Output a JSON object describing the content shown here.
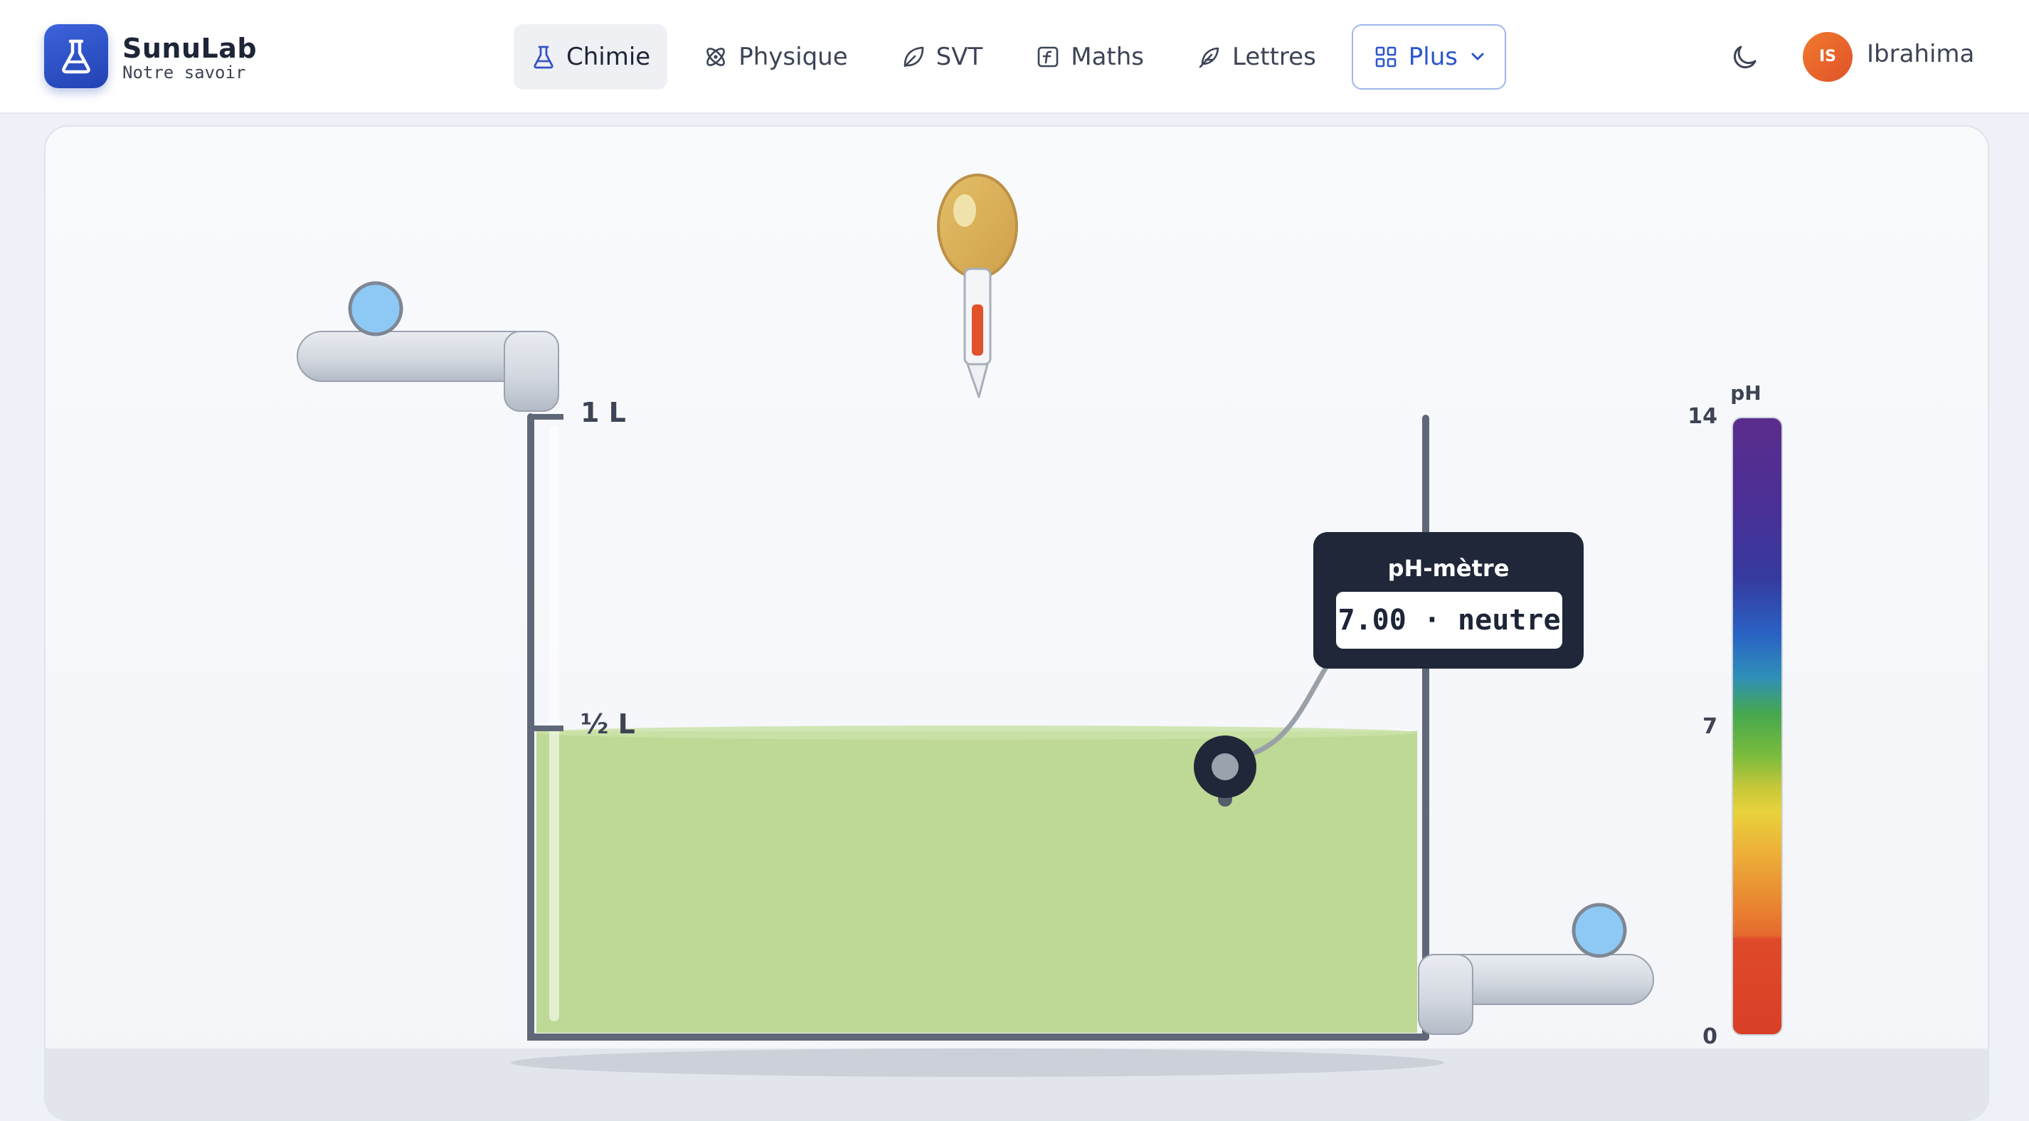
{
  "header": {
    "brand_name": "SunuLab",
    "brand_tagline": "Notre savoir",
    "nav": [
      {
        "label": "Chimie",
        "icon": "flask-icon",
        "active": true
      },
      {
        "label": "Physique",
        "icon": "atom-icon",
        "active": false
      },
      {
        "label": "SVT",
        "icon": "leaf-icon",
        "active": false
      },
      {
        "label": "Maths",
        "icon": "function-icon",
        "active": false
      },
      {
        "label": "Lettres",
        "icon": "feather-icon",
        "active": false
      }
    ],
    "more_label": "Plus",
    "user": {
      "initials": "IS",
      "name": "Ibrahima"
    }
  },
  "lab": {
    "graduations": {
      "full": "1 L",
      "half": "½ L"
    },
    "ph_meter": {
      "title": "pH-mètre",
      "reading": "7.00 · neutre"
    },
    "ph_scale": {
      "title": "pH",
      "max": "14",
      "mid": "7",
      "min": "0"
    },
    "liquid_level_fraction": 0.5,
    "liquid_color": "#bdd995",
    "pipette_fill_color": "#e0522a"
  },
  "colors": {
    "accent": "#2b55cf",
    "liquid": "#bdd995",
    "valve": "#8ec9f5",
    "avatar": "#ea6a2c"
  }
}
